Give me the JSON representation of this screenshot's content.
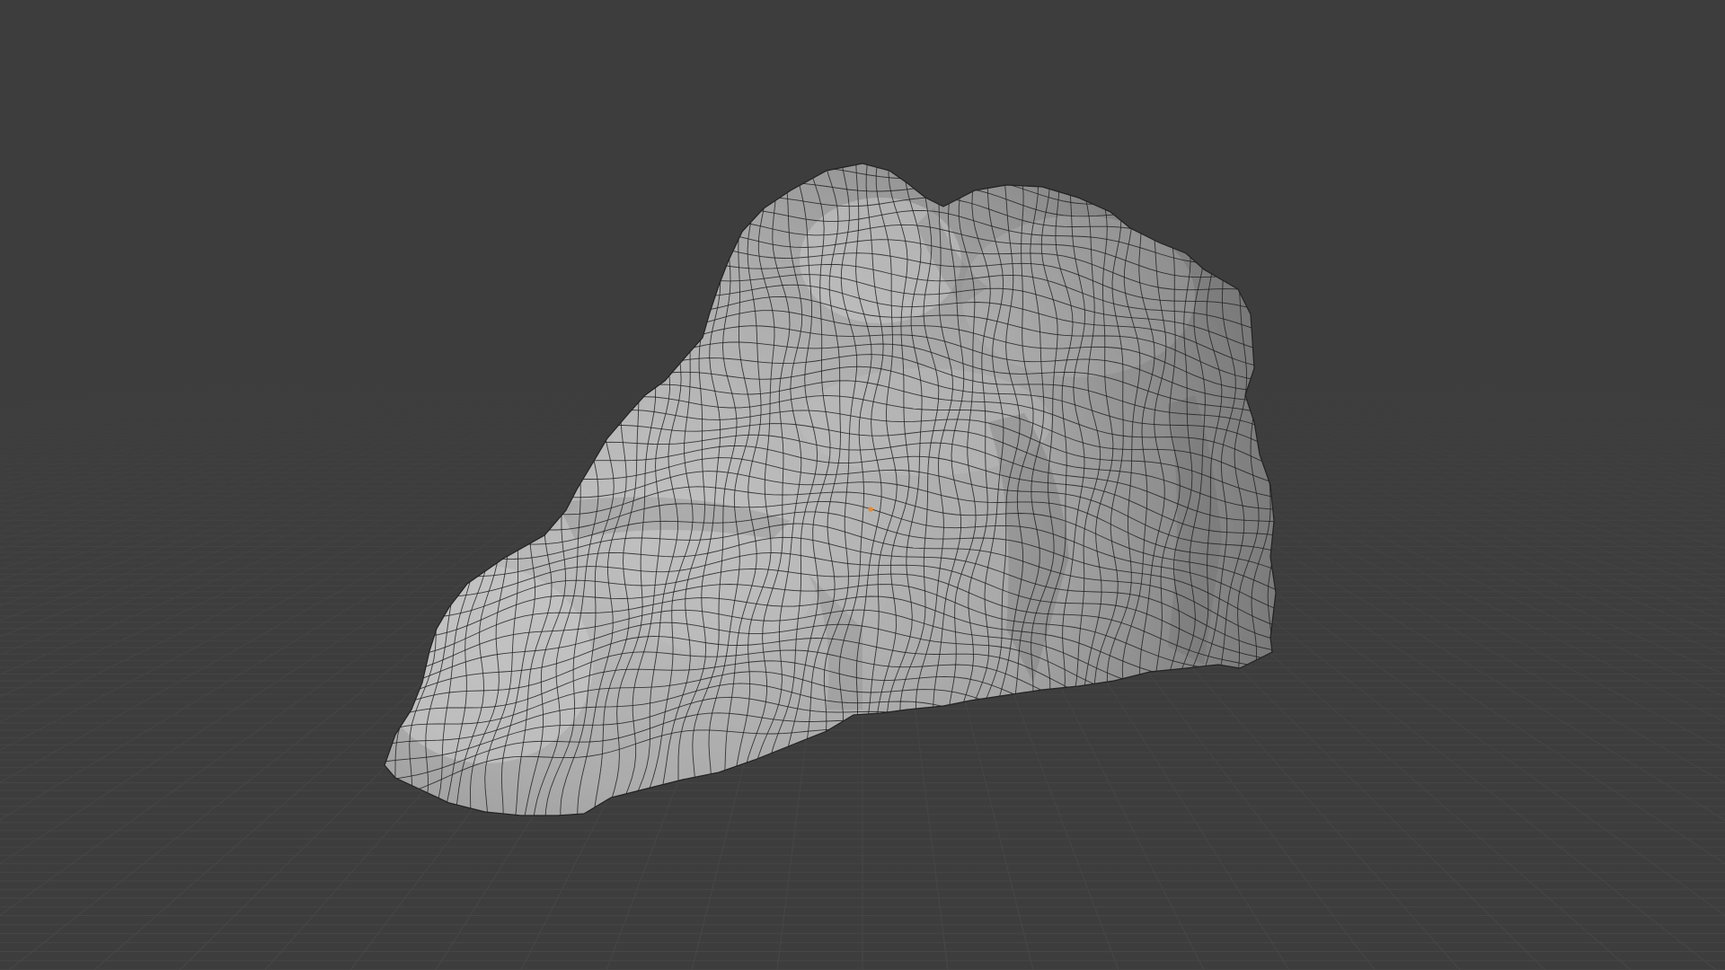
{
  "viewport": {
    "mode": "object",
    "shading": "solid",
    "overlay": "wireframe",
    "floor_grid": true
  },
  "scene": {
    "object_icon": "rock-mesh-icon",
    "origin_icon": "object-origin-icon"
  },
  "colors": {
    "background": "#3d3d3d",
    "grid_line": "#474747",
    "grid_horizon_fade": "#3d3d3d",
    "mesh_base": "#a8a8a8",
    "mesh_light": "#c4c4c4",
    "mesh_shadow": "#7e7e7e",
    "wire": "#1f1f1f",
    "origin": "#e8892a"
  }
}
